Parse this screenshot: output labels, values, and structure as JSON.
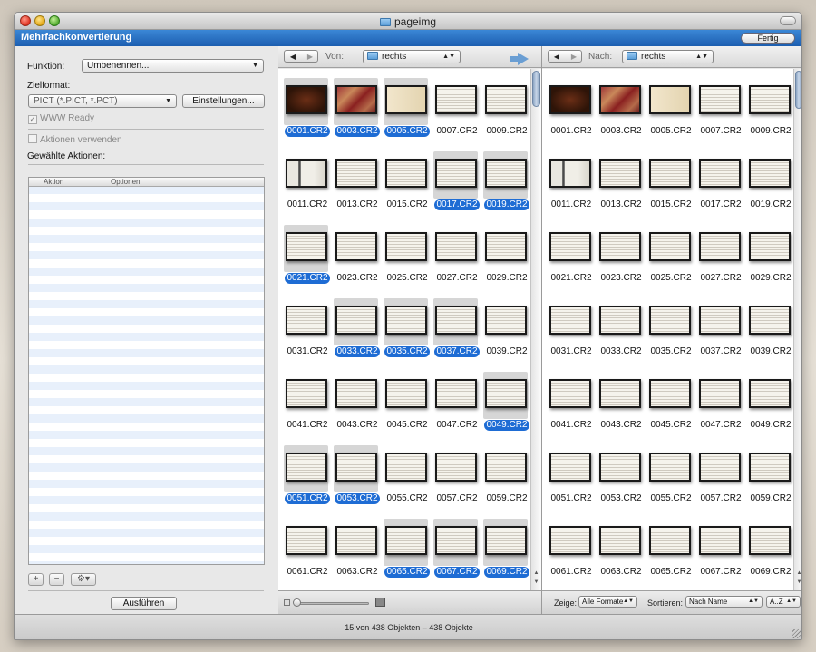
{
  "window": {
    "title": "pageimg"
  },
  "sheet": {
    "title": "Mehrfachkonvertierung",
    "done_label": "Fertig"
  },
  "left": {
    "function_label": "Funktion:",
    "function_value": "Umbenennen...",
    "target_label": "Zielformat:",
    "target_value": "PICT (*.PICT, *.PCT)",
    "settings_label": "Einstellungen...",
    "www_ready_label": "WWW Ready",
    "use_actions_label": "Aktionen verwenden",
    "selected_actions_label": "Gewählte Aktionen:",
    "col_action": "Aktion",
    "col_options": "Optionen",
    "add_label": "+",
    "remove_label": "−",
    "gear_label": "⚙▾",
    "run_label": "Ausführen"
  },
  "source": {
    "from_label": "Von:",
    "folder": "rechts",
    "files": [
      {
        "name": "0001.CR2",
        "selected": true,
        "variant": "v1"
      },
      {
        "name": "0003.CR2",
        "selected": true,
        "variant": "v2"
      },
      {
        "name": "0005.CR2",
        "selected": true,
        "variant": "v3"
      },
      {
        "name": "0007.CR2",
        "selected": false,
        "variant": "v4"
      },
      {
        "name": "0009.CR2",
        "selected": false,
        "variant": "v4"
      },
      {
        "name": "0011.CR2",
        "selected": false,
        "variant": "v6"
      },
      {
        "name": "0013.CR2",
        "selected": false,
        "variant": "v4"
      },
      {
        "name": "0015.CR2",
        "selected": false,
        "variant": "v4"
      },
      {
        "name": "0017.CR2",
        "selected": true,
        "variant": "v4"
      },
      {
        "name": "0019.CR2",
        "selected": true,
        "variant": "v4"
      },
      {
        "name": "0021.CR2",
        "selected": true,
        "variant": "v4"
      },
      {
        "name": "0023.CR2",
        "selected": false,
        "variant": "v4"
      },
      {
        "name": "0025.CR2",
        "selected": false,
        "variant": "v4"
      },
      {
        "name": "0027.CR2",
        "selected": false,
        "variant": "v4"
      },
      {
        "name": "0029.CR2",
        "selected": false,
        "variant": "v4"
      },
      {
        "name": "0031.CR2",
        "selected": false,
        "variant": "v4"
      },
      {
        "name": "0033.CR2",
        "selected": true,
        "variant": "v4"
      },
      {
        "name": "0035.CR2",
        "selected": true,
        "variant": "v4"
      },
      {
        "name": "0037.CR2",
        "selected": true,
        "variant": "v4"
      },
      {
        "name": "0039.CR2",
        "selected": false,
        "variant": "v4"
      },
      {
        "name": "0041.CR2",
        "selected": false,
        "variant": "v4"
      },
      {
        "name": "0043.CR2",
        "selected": false,
        "variant": "v4"
      },
      {
        "name": "0045.CR2",
        "selected": false,
        "variant": "v4"
      },
      {
        "name": "0047.CR2",
        "selected": false,
        "variant": "v4"
      },
      {
        "name": "0049.CR2",
        "selected": true,
        "variant": "v4"
      },
      {
        "name": "0051.CR2",
        "selected": true,
        "variant": "v4"
      },
      {
        "name": "0053.CR2",
        "selected": true,
        "variant": "v4"
      },
      {
        "name": "0055.CR2",
        "selected": false,
        "variant": "v4"
      },
      {
        "name": "0057.CR2",
        "selected": false,
        "variant": "v4"
      },
      {
        "name": "0059.CR2",
        "selected": false,
        "variant": "v4"
      },
      {
        "name": "0061.CR2",
        "selected": false,
        "variant": "v4"
      },
      {
        "name": "0063.CR2",
        "selected": false,
        "variant": "v4"
      },
      {
        "name": "0065.CR2",
        "selected": true,
        "variant": "v4"
      },
      {
        "name": "0067.CR2",
        "selected": true,
        "variant": "v4"
      },
      {
        "name": "0069.CR2",
        "selected": true,
        "variant": "v4"
      }
    ]
  },
  "destination": {
    "to_label": "Nach:",
    "folder": "rechts",
    "show_label": "Zeige:",
    "show_value": "Alle Formate",
    "sort_label": "Sortieren:",
    "sort_value": "Nach Name",
    "order_value": "A..Z"
  },
  "status": {
    "text": "15 von 438 Objekten – 438 Objekte"
  }
}
